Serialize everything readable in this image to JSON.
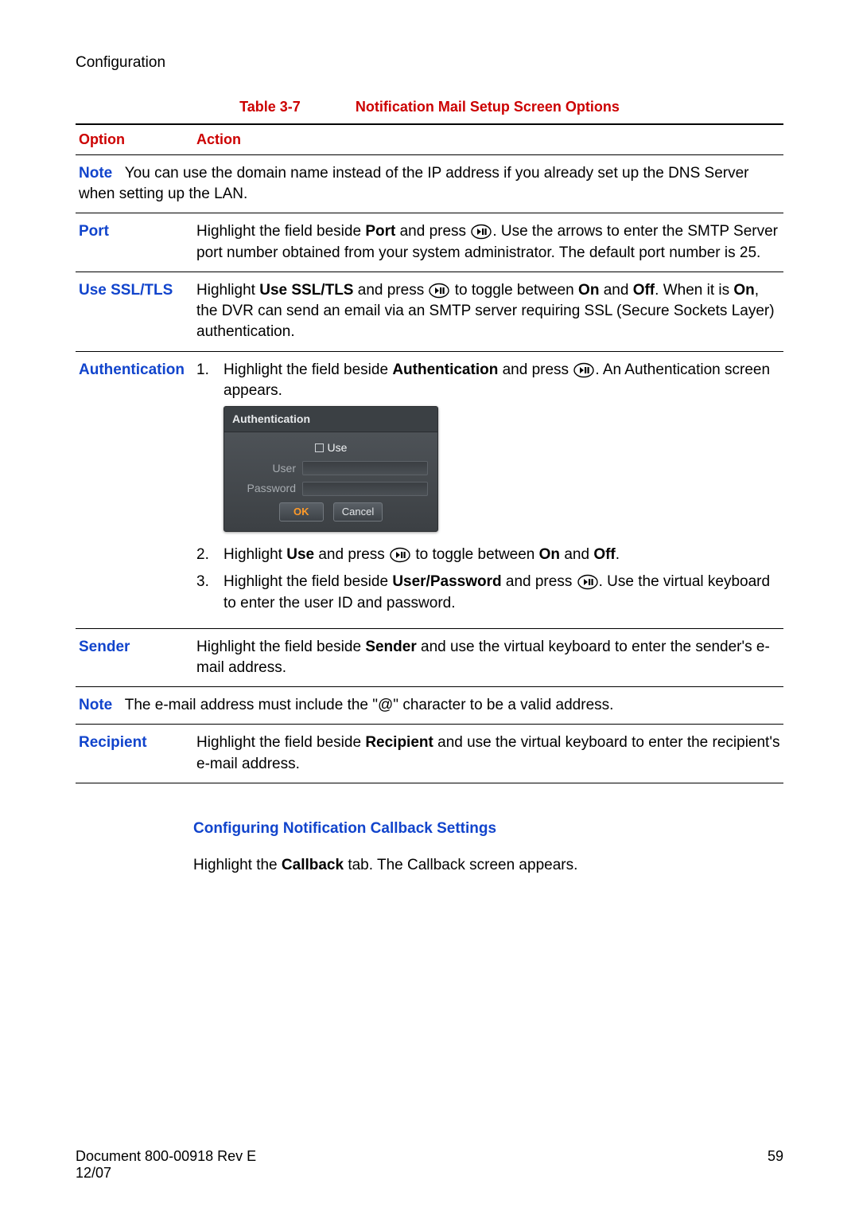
{
  "page": {
    "section_title": "Configuration",
    "table_num": "Table 3-7",
    "table_title": "Notification Mail Setup Screen Options",
    "col_option": "Option",
    "col_action": "Action",
    "rows": {
      "note1_label": "Note",
      "note1_text": "You can use the domain name instead of the IP address if you already set up the DNS Server when setting up the LAN.",
      "port_label": "Port",
      "port_pre": "Highlight the field beside ",
      "port_b1": "Port",
      "port_mid": " and press ",
      "port_post": ". Use the arrows to enter the SMTP Server port number obtained from your system administrator. The default port number is 25.",
      "ssl_label": "Use SSL/TLS",
      "ssl_pre": "Highlight ",
      "ssl_b1": "Use SSL/TLS",
      "ssl_mid": " and press ",
      "ssl_mid2": " to toggle between ",
      "ssl_on": "On",
      "ssl_and": " and ",
      "ssl_off": "Off",
      "ssl_post1": ". When it is ",
      "ssl_on2": "On",
      "ssl_post2": ", the DVR can send an email via an SMTP server requiring SSL (Secure Sockets Layer) authentication.",
      "auth_label": "Authentication",
      "auth_s1_pre": "Highlight the field beside ",
      "auth_s1_b": "Authentication",
      "auth_s1_mid": " and press ",
      "auth_s1_post": ". An Authentication screen appears.",
      "auth_s2_pre": "Highlight ",
      "auth_s2_b": "Use",
      "auth_s2_mid": " and press ",
      "auth_s2_mid2": " to toggle between ",
      "auth_s2_on": "On",
      "auth_s2_and": " and ",
      "auth_s2_off": "Off",
      "auth_s2_end": ".",
      "auth_s3_pre": "Highlight the field beside ",
      "auth_s3_b": "User/Password",
      "auth_s3_mid": " and press ",
      "auth_s3_post": ". Use the virtual keyboard to enter the user ID and password.",
      "sender_label": "Sender",
      "sender_pre": "Highlight the field beside ",
      "sender_b": "Sender",
      "sender_post": " and use the virtual keyboard to enter the sender's e-mail address.",
      "note2_label": "Note",
      "note2_text": "The e-mail address must include the \"@\" character to be a valid address.",
      "recip_label": "Recipient",
      "recip_pre": "Highlight the field beside ",
      "recip_b": "Recipient",
      "recip_post": " and use the virtual keyboard to enter the recipient's e-mail address."
    },
    "auth_dialog": {
      "title": "Authentication",
      "use_label": "Use",
      "user_label": "User",
      "password_label": "Password",
      "ok": "OK",
      "cancel": "Cancel"
    },
    "subsection_title": "Configuring Notification Callback Settings",
    "callback_pre": "Highlight the ",
    "callback_b": "Callback",
    "callback_post": " tab. The Callback screen appears.",
    "footer_doc": "Document 800-00918 Rev E",
    "footer_date": "12/07",
    "footer_page": "59"
  },
  "nums": {
    "one": "1.",
    "two": "2.",
    "three": "3."
  }
}
